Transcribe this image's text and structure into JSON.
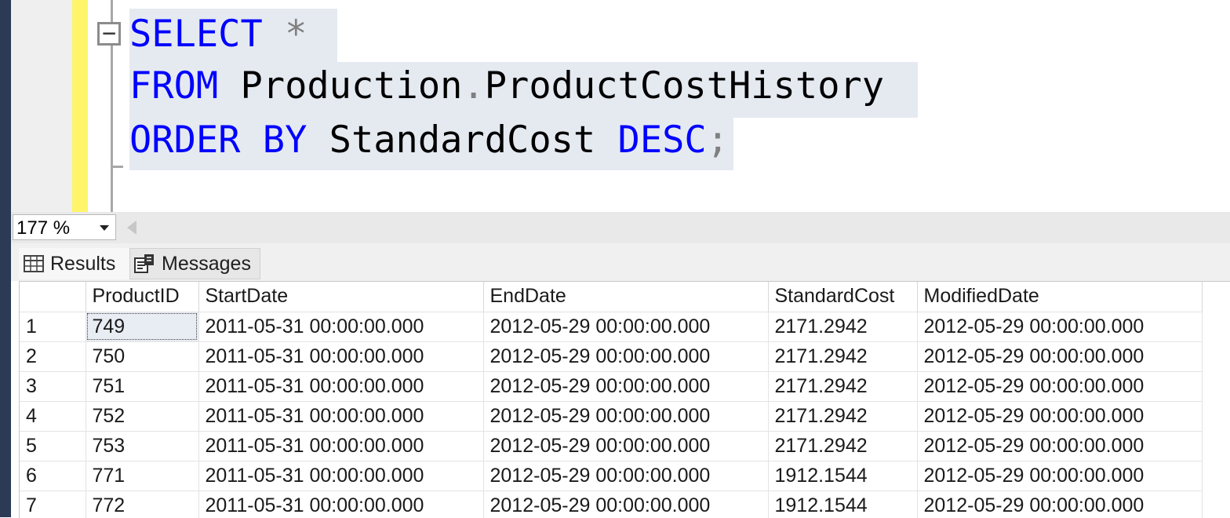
{
  "editor": {
    "code_lines": [
      [
        {
          "t": "SELECT",
          "c": "kw"
        },
        {
          "t": " ",
          "c": ""
        },
        {
          "t": "*",
          "c": "punct"
        }
      ],
      [
        {
          "t": "FROM",
          "c": "kw"
        },
        {
          "t": " Production",
          "c": ""
        },
        {
          "t": ".",
          "c": "punct"
        },
        {
          "t": "ProductCostHistory",
          "c": ""
        }
      ],
      [
        {
          "t": "ORDER",
          "c": "kw"
        },
        {
          "t": " ",
          "c": ""
        },
        {
          "t": "BY",
          "c": "kw"
        },
        {
          "t": " StandardCost ",
          "c": ""
        },
        {
          "t": "DESC",
          "c": "kw"
        },
        {
          "t": ";",
          "c": "punct"
        }
      ]
    ],
    "collapse_glyph": "−"
  },
  "status": {
    "zoom": "177 %"
  },
  "tabs": {
    "results": "Results",
    "messages": "Messages"
  },
  "grid": {
    "columns": [
      "",
      "ProductID",
      "StartDate",
      "EndDate",
      "StandardCost",
      "ModifiedDate"
    ],
    "rows": [
      [
        "1",
        "749",
        "2011-05-31 00:00:00.000",
        "2012-05-29 00:00:00.000",
        "2171.2942",
        "2012-05-29 00:00:00.000"
      ],
      [
        "2",
        "750",
        "2011-05-31 00:00:00.000",
        "2012-05-29 00:00:00.000",
        "2171.2942",
        "2012-05-29 00:00:00.000"
      ],
      [
        "3",
        "751",
        "2011-05-31 00:00:00.000",
        "2012-05-29 00:00:00.000",
        "2171.2942",
        "2012-05-29 00:00:00.000"
      ],
      [
        "4",
        "752",
        "2011-05-31 00:00:00.000",
        "2012-05-29 00:00:00.000",
        "2171.2942",
        "2012-05-29 00:00:00.000"
      ],
      [
        "5",
        "753",
        "2011-05-31 00:00:00.000",
        "2012-05-29 00:00:00.000",
        "2171.2942",
        "2012-05-29 00:00:00.000"
      ],
      [
        "6",
        "771",
        "2011-05-31 00:00:00.000",
        "2012-05-29 00:00:00.000",
        "1912.1544",
        "2012-05-29 00:00:00.000"
      ],
      [
        "7",
        "772",
        "2011-05-31 00:00:00.000",
        "2012-05-29 00:00:00.000",
        "1912.1544",
        "2012-05-29 00:00:00.000"
      ]
    ],
    "selected_cell": {
      "row": 0,
      "col": 1
    }
  },
  "colors": {
    "keyword": "#0000ff",
    "punctuation": "#808080",
    "selection": "#e5eaf1",
    "change_bar": "#fff46a"
  },
  "icons": {
    "results_tab": "grid-table-icon",
    "messages_tab": "message-document-icon",
    "zoom_dropdown": "chevron-down-icon",
    "outline_toggle": "collapse-minus-icon"
  }
}
